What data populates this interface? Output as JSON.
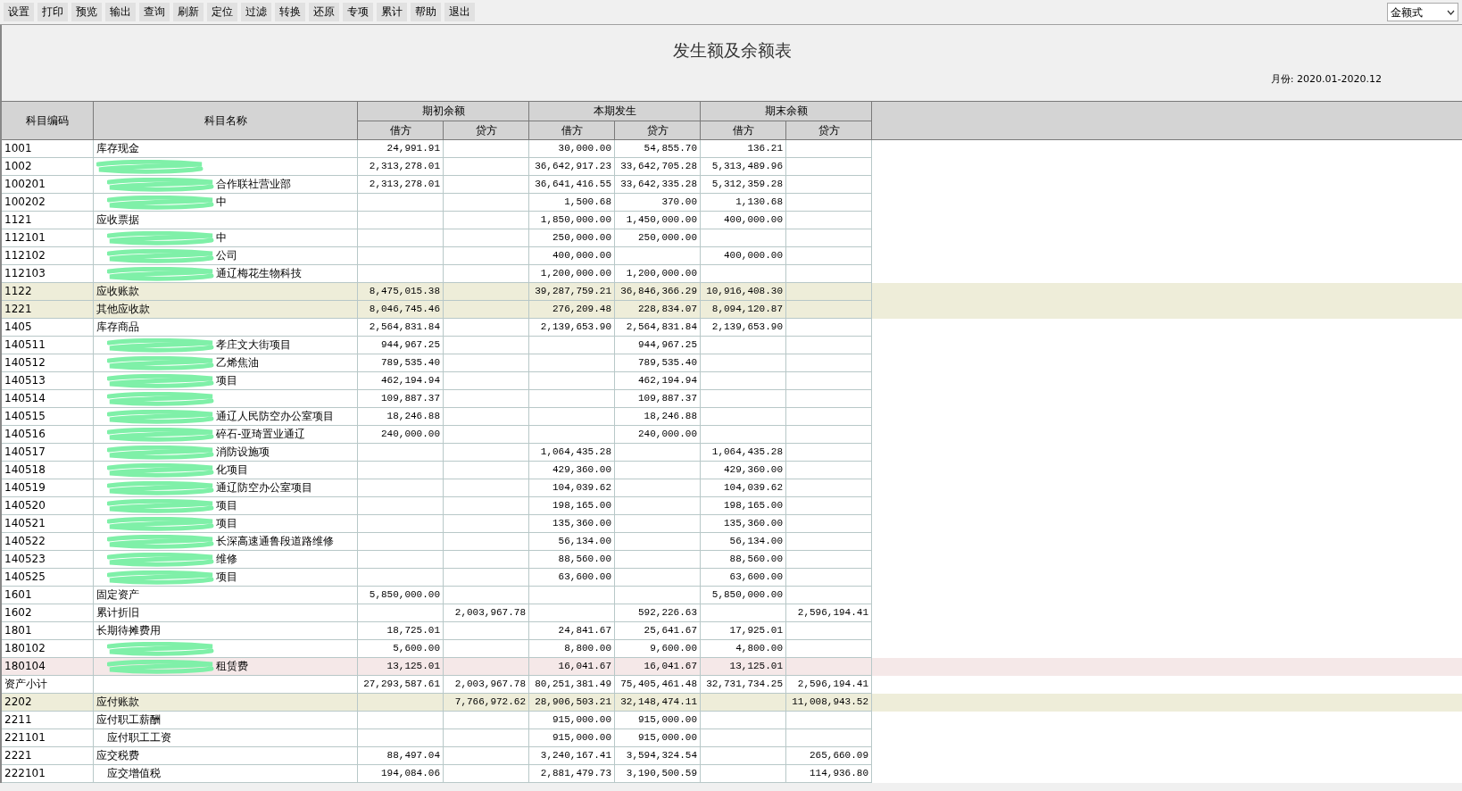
{
  "toolbar": [
    "设置",
    "打印",
    "预览",
    "输出",
    "查询",
    "刷新",
    "定位",
    "过滤",
    "转换",
    "还原",
    "专项",
    "累计",
    "帮助",
    "退出"
  ],
  "format_select": {
    "value": "金额式"
  },
  "title": "发生额及余额表",
  "period": "月份: 2020.01-2020.12",
  "column_groups": [
    {
      "label": "期初余额",
      "columns": [
        "借方",
        "贷方"
      ]
    },
    {
      "label": "本期发生",
      "columns": [
        "借方",
        "贷方"
      ]
    },
    {
      "label": "期末余额",
      "columns": [
        "借方",
        "贷方"
      ]
    }
  ],
  "code_header": "科目编码",
  "name_header": "科目名称",
  "rows": [
    {
      "code": "1001",
      "name": "库存现金",
      "values": {
        "od": "24,991.91",
        "pd": "30,000.00",
        "pc": "54,855.70",
        "cd": "136.21"
      }
    },
    {
      "code": "1002",
      "redacted": true,
      "values": {
        "od": "2,313,278.01",
        "pd": "36,642,917.23",
        "pc": "33,642,705.28",
        "cd": "5,313,489.96"
      },
      "children": [
        {
          "code": "100201",
          "name": "合作联社营业部",
          "redacted": true,
          "values": {
            "od": "2,313,278.01",
            "pd": "36,641,416.55",
            "pc": "33,642,335.28",
            "cd": "5,312,359.28"
          }
        },
        {
          "code": "100202",
          "name": "中",
          "redacted": true,
          "values": {
            "pd": "1,500.68",
            "pc": "370.00",
            "cd": "1,130.68"
          }
        }
      ]
    },
    {
      "code": "1121",
      "name": "应收票据",
      "values": {
        "pd": "1,850,000.00",
        "pc": "1,450,000.00",
        "cd": "400,000.00"
      },
      "children": [
        {
          "code": "112101",
          "name": "中",
          "redacted": true,
          "values": {
            "pd": "250,000.00",
            "pc": "250,000.00"
          }
        },
        {
          "code": "112102",
          "name": "公司",
          "redacted": true,
          "values": {
            "pd": "400,000.00",
            "cd": "400,000.00"
          }
        },
        {
          "code": "112103",
          "name": "通辽梅花生物科技",
          "redacted": true,
          "values": {
            "pd": "1,200,000.00",
            "pc": "1,200,000.00"
          }
        }
      ]
    },
    {
      "code": "1122",
      "name": "应收账款",
      "color": "#eeedd9",
      "values": {
        "od": "8,475,015.38",
        "pd": "39,287,759.21",
        "pc": "36,846,366.29",
        "cd": "10,916,408.30"
      }
    },
    {
      "code": "1221",
      "name": "其他应收款",
      "color": "#eeedd9",
      "values": {
        "od": "8,046,745.46",
        "pd": "276,209.48",
        "pc": "228,834.07",
        "cd": "8,094,120.87"
      }
    },
    {
      "code": "1405",
      "name": "库存商品",
      "values": {
        "od": "2,564,831.84",
        "pd": "2,139,653.90",
        "pc": "2,564,831.84",
        "cd": "2,139,653.90"
      },
      "children": [
        {
          "code": "140511",
          "name": "孝庄文大街项目",
          "redacted": true,
          "values": {
            "od": "944,967.25",
            "pc": "944,967.25"
          }
        },
        {
          "code": "140512",
          "name": "乙烯焦油",
          "redacted": true,
          "values": {
            "od": "789,535.40",
            "pc": "789,535.40"
          }
        },
        {
          "code": "140513",
          "name": "项目",
          "redacted": true,
          "values": {
            "od": "462,194.94",
            "pc": "462,194.94"
          }
        },
        {
          "code": "140514",
          "redacted": true,
          "values": {
            "od": "109,887.37",
            "pc": "109,887.37"
          }
        },
        {
          "code": "140515",
          "name": "通辽人民防空办公室项目",
          "redacted": true,
          "values": {
            "od": "18,246.88",
            "pc": "18,246.88"
          }
        },
        {
          "code": "140516",
          "name": "碎石-亚琦置业通辽",
          "redacted": true,
          "values": {
            "od": "240,000.00",
            "pc": "240,000.00"
          }
        },
        {
          "code": "140517",
          "name": "消防设施项",
          "redacted": true,
          "values": {
            "pd": "1,064,435.28",
            "cd": "1,064,435.28"
          }
        },
        {
          "code": "140518",
          "name": "化项目",
          "redacted": true,
          "values": {
            "pd": "429,360.00",
            "cd": "429,360.00"
          }
        },
        {
          "code": "140519",
          "name": "通辽防空办公室项目",
          "redacted": true,
          "values": {
            "pd": "104,039.62",
            "cd": "104,039.62"
          }
        },
        {
          "code": "140520",
          "name": "项目",
          "redacted": true,
          "values": {
            "pd": "198,165.00",
            "cd": "198,165.00"
          }
        },
        {
          "code": "140521",
          "name": "项目",
          "redacted": true,
          "values": {
            "pd": "135,360.00",
            "cd": "135,360.00"
          }
        },
        {
          "code": "140522",
          "name": "长深高速通鲁段道路维修",
          "redacted": true,
          "values": {
            "pd": "56,134.00",
            "cd": "56,134.00"
          }
        },
        {
          "code": "140523",
          "name": "维修",
          "redacted": true,
          "values": {
            "pd": "88,560.00",
            "cd": "88,560.00"
          }
        },
        {
          "code": "140525",
          "name": "项目",
          "redacted": true,
          "values": {
            "pd": "63,600.00",
            "cd": "63,600.00"
          }
        }
      ]
    },
    {
      "code": "1601",
      "name": "固定资产",
      "values": {
        "od": "5,850,000.00",
        "cd": "5,850,000.00"
      }
    },
    {
      "code": "1602",
      "name": "累计折旧",
      "values": {
        "oc": "2,003,967.78",
        "pc": "592,226.63",
        "cc": "2,596,194.41"
      }
    },
    {
      "code": "1801",
      "name": "长期待摊费用",
      "values": {
        "od": "18,725.01",
        "pd": "24,841.67",
        "pc": "25,641.67",
        "cd": "17,925.01"
      },
      "children": [
        {
          "code": "180102",
          "redacted": true,
          "values": {
            "od": "5,600.00",
            "pd": "8,800.00",
            "pc": "9,600.00",
            "cd": "4,800.00"
          }
        },
        {
          "code": "180104",
          "name": "租赁费",
          "redacted": true,
          "color": "#f5e8e8",
          "values": {
            "od": "13,125.01",
            "pd": "16,041.67",
            "pc": "16,041.67",
            "cd": "13,125.01"
          }
        }
      ]
    },
    {
      "code": "资产小计",
      "values": {
        "od": "27,293,587.61",
        "oc": "2,003,967.78",
        "pd": "80,251,381.49",
        "pc": "75,405,461.48",
        "cd": "32,731,734.25",
        "cc": "2,596,194.41"
      }
    },
    {
      "code": "2202",
      "name": "应付账款",
      "color": "#eeedd9",
      "values": {
        "oc": "7,766,972.62",
        "pd": "28,906,503.21",
        "pc": "32,148,474.11",
        "cc": "11,008,943.52"
      }
    },
    {
      "code": "2211",
      "name": "应付职工薪酬",
      "values": {
        "pd": "915,000.00",
        "pc": "915,000.00"
      },
      "children": [
        {
          "code": "221101",
          "name": "应付职工工资",
          "values": {
            "pd": "915,000.00",
            "pc": "915,000.00"
          }
        }
      ]
    },
    {
      "code": "2221",
      "name": "应交税费",
      "values": {
        "od": "88,497.04",
        "pd": "3,240,167.41",
        "pc": "3,594,324.54",
        "cc": "265,660.09"
      },
      "children": [
        {
          "code": "222101",
          "name": "应交增值税",
          "values": {
            "od": "194,084.06",
            "pd": "2,881,479.73",
            "pc": "3,190,500.59",
            "cc": "114,936.80"
          }
        }
      ]
    }
  ]
}
